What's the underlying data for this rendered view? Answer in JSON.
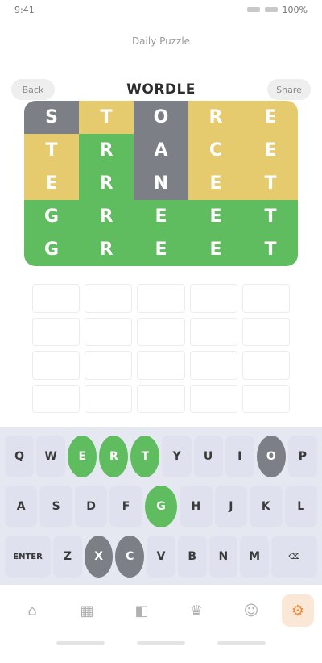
{
  "status": {
    "time": "9:41",
    "battery": "100%"
  },
  "header": {
    "subtitle": "Daily Puzzle",
    "title": "WORDLE",
    "back_label": "Back",
    "share_label": "Share"
  },
  "colors": {
    "green": "#5fbd5f",
    "yellow": "#e6cb6e",
    "gray": "#7c7f86",
    "key_bg": "#dfe2ee",
    "keyboard_bg": "#e6e8f1"
  },
  "board": {
    "rows": [
      [
        {
          "letter": "S",
          "state": "gray"
        },
        {
          "letter": "T",
          "state": "yellow"
        },
        {
          "letter": "O",
          "state": "gray"
        },
        {
          "letter": "R",
          "state": "yellow"
        },
        {
          "letter": "E",
          "state": "yellow"
        }
      ],
      [
        {
          "letter": "T",
          "state": "yellow"
        },
        {
          "letter": "R",
          "state": "green"
        },
        {
          "letter": "A",
          "state": "gray"
        },
        {
          "letter": "C",
          "state": "yellow"
        },
        {
          "letter": "E",
          "state": "yellow"
        }
      ],
      [
        {
          "letter": "E",
          "state": "yellow"
        },
        {
          "letter": "R",
          "state": "green"
        },
        {
          "letter": "N",
          "state": "gray"
        },
        {
          "letter": "E",
          "state": "yellow"
        },
        {
          "letter": "T",
          "state": "yellow"
        }
      ],
      [
        {
          "letter": "G",
          "state": "green"
        },
        {
          "letter": "R",
          "state": "green"
        },
        {
          "letter": "E",
          "state": "green"
        },
        {
          "letter": "E",
          "state": "green"
        },
        {
          "letter": "T",
          "state": "green"
        }
      ],
      [
        {
          "letter": "G",
          "state": "green"
        },
        {
          "letter": "R",
          "state": "green"
        },
        {
          "letter": "E",
          "state": "green"
        },
        {
          "letter": "E",
          "state": "green"
        },
        {
          "letter": "T",
          "state": "green"
        }
      ]
    ]
  },
  "keyboard": {
    "row1": [
      {
        "label": "Q",
        "state": ""
      },
      {
        "label": "W",
        "state": ""
      },
      {
        "label": "E",
        "state": "green"
      },
      {
        "label": "R",
        "state": "green"
      },
      {
        "label": "T",
        "state": "green"
      },
      {
        "label": "Y",
        "state": ""
      },
      {
        "label": "U",
        "state": ""
      },
      {
        "label": "I",
        "state": ""
      },
      {
        "label": "O",
        "state": "gray"
      },
      {
        "label": "P",
        "state": ""
      }
    ],
    "row2": [
      {
        "label": "A",
        "state": ""
      },
      {
        "label": "S",
        "state": ""
      },
      {
        "label": "D",
        "state": ""
      },
      {
        "label": "F",
        "state": ""
      },
      {
        "label": "G",
        "state": "green"
      },
      {
        "label": "H",
        "state": ""
      },
      {
        "label": "J",
        "state": ""
      },
      {
        "label": "K",
        "state": ""
      },
      {
        "label": "L",
        "state": ""
      }
    ],
    "row3": [
      {
        "label": "ENTER",
        "state": "",
        "kind": "enter"
      },
      {
        "label": "Z",
        "state": ""
      },
      {
        "label": "X",
        "state": "gray"
      },
      {
        "label": "C",
        "state": "gray"
      },
      {
        "label": "V",
        "state": ""
      },
      {
        "label": "B",
        "state": ""
      },
      {
        "label": "N",
        "state": ""
      },
      {
        "label": "M",
        "state": ""
      },
      {
        "label": "⌫",
        "state": "",
        "kind": "del"
      }
    ]
  },
  "tabs": [
    {
      "icon": "home-icon",
      "glyph": "⌂"
    },
    {
      "icon": "chart-icon",
      "glyph": "▦"
    },
    {
      "icon": "puzzle-icon",
      "glyph": "◧"
    },
    {
      "icon": "trophy-icon",
      "glyph": "♛"
    },
    {
      "icon": "user-icon",
      "glyph": "☺"
    },
    {
      "icon": "settings-icon",
      "glyph": "⚙",
      "active": true
    }
  ]
}
